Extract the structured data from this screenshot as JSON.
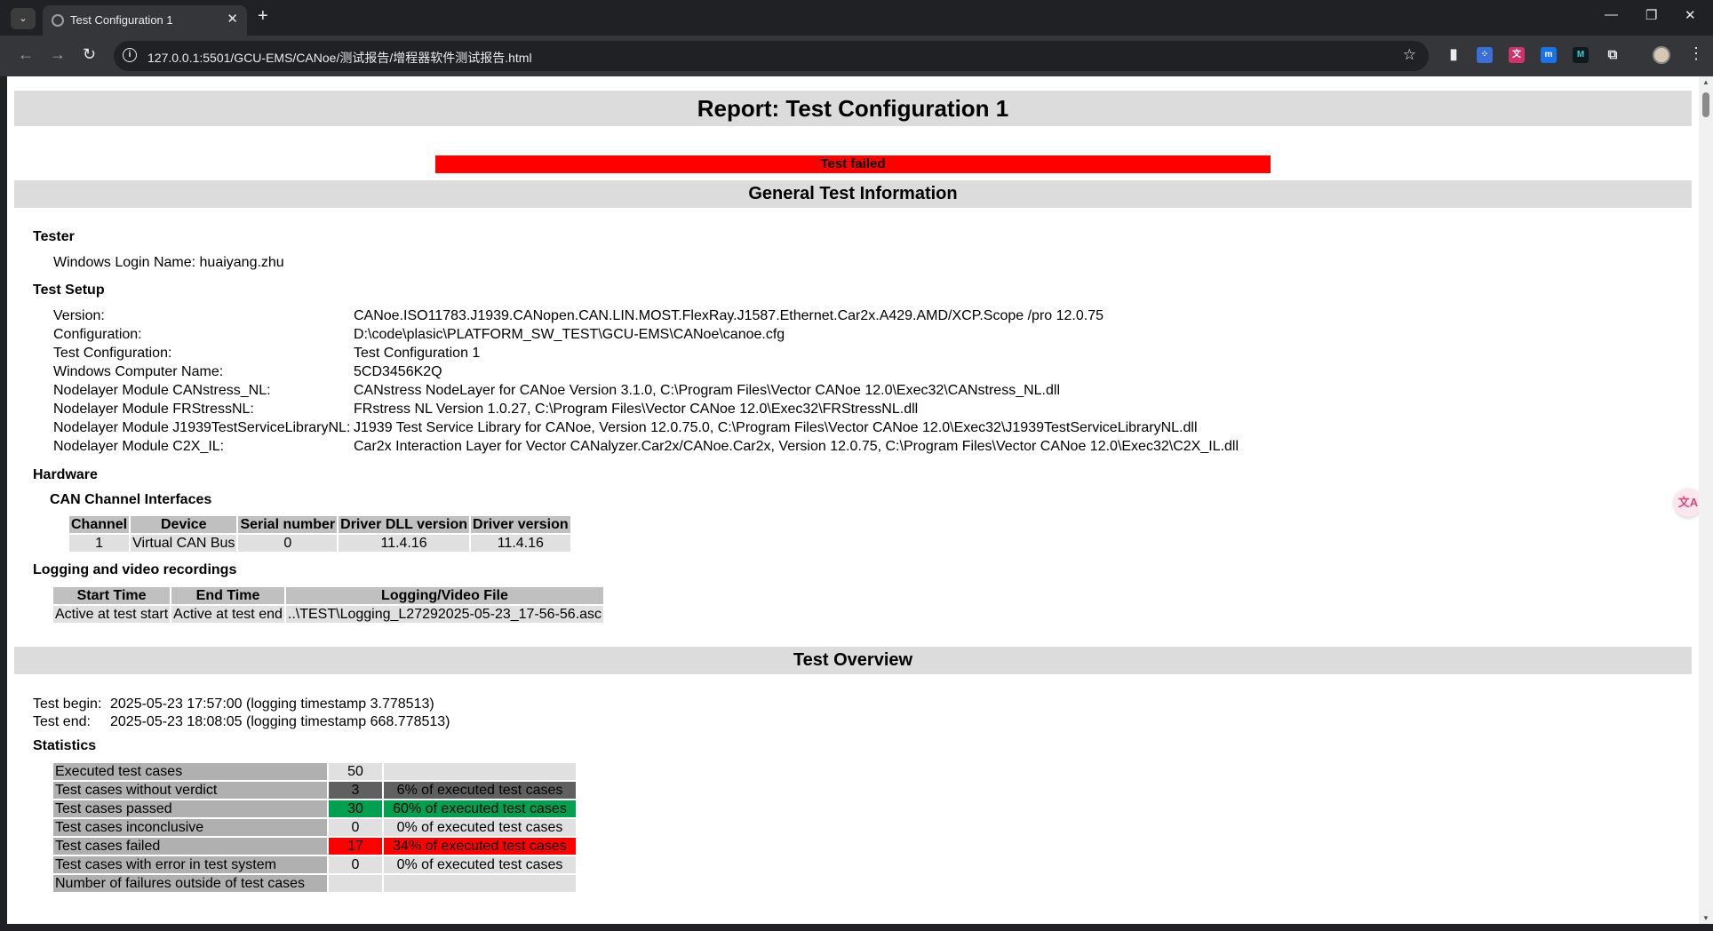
{
  "browser": {
    "tab_title": "Test Configuration 1",
    "url": "127.0.0.1:5501/GCU-EMS/CANoe/测试报告/增程器软件测试报告.html",
    "icons": [
      "tab-search-icon",
      "favicon-icon",
      "close-icon",
      "new-tab-icon",
      "minimize-icon",
      "restore-icon",
      "close-window-icon",
      "back-icon",
      "forward-icon",
      "reload-icon",
      "site-info-icon",
      "bookmark-star-icon",
      "bookmarks-icon",
      "extension-icons",
      "extensions-puzzle-icon",
      "profile-avatar",
      "menu-kebab-icon"
    ]
  },
  "report": {
    "title": "Report: Test Configuration 1",
    "verdict": "Test failed",
    "general_heading": "General Test Information",
    "tester": {
      "heading": "Tester",
      "login_line": "Windows Login Name: huaiyang.zhu"
    },
    "setup": {
      "heading": "Test Setup",
      "rows": [
        {
          "k": "Version:",
          "v": "CANoe.ISO11783.J1939.CANopen.CAN.LIN.MOST.FlexRay.J1587.Ethernet.Car2x.A429.AMD/XCP.Scope /pro 12.0.75"
        },
        {
          "k": "Configuration:",
          "v": "D:\\code\\plasic\\PLATFORM_SW_TEST\\GCU-EMS\\CANoe\\canoe.cfg"
        },
        {
          "k": "Test Configuration:",
          "v": "Test Configuration 1"
        },
        {
          "k": "Windows Computer Name:",
          "v": "5CD3456K2Q"
        },
        {
          "k": "Nodelayer Module CANstress_NL:",
          "v": "CANstress NodeLayer for CANoe Version 3.1.0, C:\\Program Files\\Vector CANoe 12.0\\Exec32\\CANstress_NL.dll"
        },
        {
          "k": "Nodelayer Module FRStressNL:",
          "v": "FRstress NL Version 1.0.27, C:\\Program Files\\Vector CANoe 12.0\\Exec32\\FRStressNL.dll"
        },
        {
          "k": "Nodelayer Module J1939TestServiceLibraryNL:",
          "v": "J1939 Test Service Library for CANoe, Version 12.0.75.0, C:\\Program Files\\Vector CANoe 12.0\\Exec32\\J1939TestServiceLibraryNL.dll"
        },
        {
          "k": "Nodelayer Module C2X_IL:",
          "v": "Car2x Interaction Layer for Vector CANalyzer.Car2x/CANoe.Car2x, Version 12.0.75, C:\\Program Files\\Vector CANoe 12.0\\Exec32\\C2X_IL.dll"
        }
      ]
    },
    "hardware": {
      "heading": "Hardware",
      "can_heading": "CAN Channel Interfaces",
      "headers": [
        "Channel",
        "Device",
        "Serial number",
        "Driver DLL version",
        "Driver version"
      ],
      "row": [
        "1",
        "Virtual CAN Bus",
        "0",
        "11.4.16",
        "11.4.16"
      ]
    },
    "logging": {
      "heading": "Logging and video recordings",
      "headers": [
        "Start Time",
        "End Time",
        "Logging/Video File"
      ],
      "row": [
        "Active at test start",
        "Active at test end",
        "..\\TEST\\Logging_L27292025-05-23_17-56-56.asc"
      ]
    },
    "overview": {
      "heading": "Test Overview",
      "begin_label": "Test begin:",
      "begin_value": "2025-05-23 17:57:00  (logging timestamp 3.778513)",
      "end_label": "Test end:",
      "end_value": "2025-05-23 18:08:05  (logging timestamp 668.778513)"
    },
    "statistics": {
      "heading": "Statistics",
      "rows": [
        {
          "label": "Executed test cases",
          "num": "50",
          "pct": "",
          "color": "light"
        },
        {
          "label": "Test cases without verdict",
          "num": "3",
          "pct": "6% of executed test cases",
          "color": "dark"
        },
        {
          "label": "Test cases passed",
          "num": "30",
          "pct": "60% of executed test cases",
          "color": "green"
        },
        {
          "label": "Test cases inconclusive",
          "num": "0",
          "pct": "0% of executed test cases",
          "color": "light"
        },
        {
          "label": "Test cases failed",
          "num": "17",
          "pct": "34% of executed test cases",
          "color": "red"
        },
        {
          "label": "Test cases with error in test system",
          "num": "0",
          "pct": "0% of executed test cases",
          "color": "light"
        },
        {
          "label": "Number of failures outside of test cases",
          "num": "",
          "pct": "",
          "color": "light"
        }
      ]
    }
  }
}
